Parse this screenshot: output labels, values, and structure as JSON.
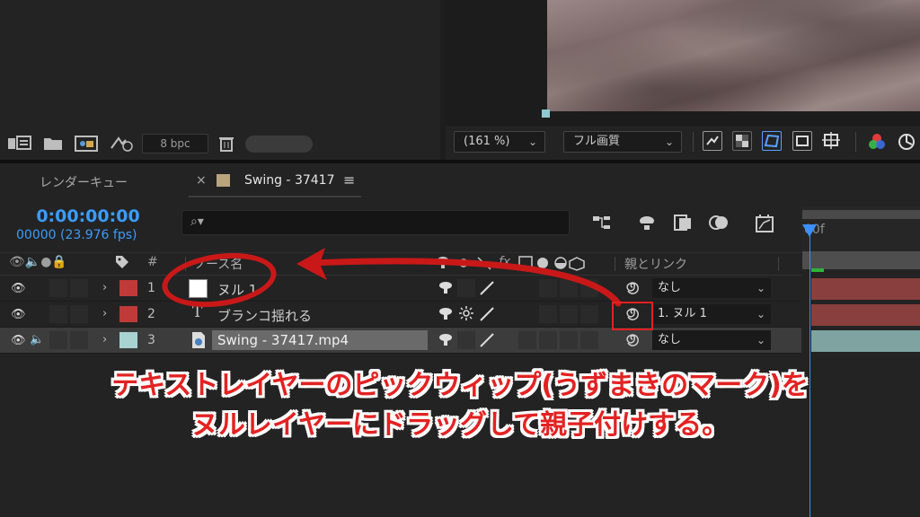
{
  "project_panel": {
    "bpc_label": "8 bpc"
  },
  "viewer": {
    "zoom": "(161 %)",
    "resolution": "フル画質"
  },
  "timeline": {
    "tabs": [
      {
        "label": "レンダーキュー"
      },
      {
        "label": "Swing - 37417",
        "close": "×",
        "menu": "≡"
      }
    ],
    "timecode": "0:00:00:00",
    "frames": "00000 (23.976 fps)",
    "ruler_start": "00f",
    "columns": {
      "num": "#",
      "source_name": "ソース名",
      "switches_fx": "fx",
      "parent_link": "親とリンク"
    },
    "layers": [
      {
        "num": "1",
        "name": "ヌル 1",
        "label_color": "#c03a3a",
        "parent": "なし",
        "type": "null"
      },
      {
        "num": "2",
        "name": "ブランコ揺れる",
        "label_color": "#c03a3a",
        "parent": "1. ヌル 1",
        "type": "text",
        "type_glyph": "T"
      },
      {
        "num": "3",
        "name": "Swing - 37417.mp4",
        "label_color": "#a8d3d0",
        "parent": "なし",
        "type": "footage"
      }
    ]
  },
  "annotation": {
    "line1": "テキストレイヤーのピックウィップ(うずまきのマーク)を",
    "line2": "ヌルレイヤーにドラッグして親子付けする。",
    "color": "#e32222"
  },
  "colors": {
    "accent_blue": "#3b9cff",
    "annotation_red": "#c91818"
  }
}
